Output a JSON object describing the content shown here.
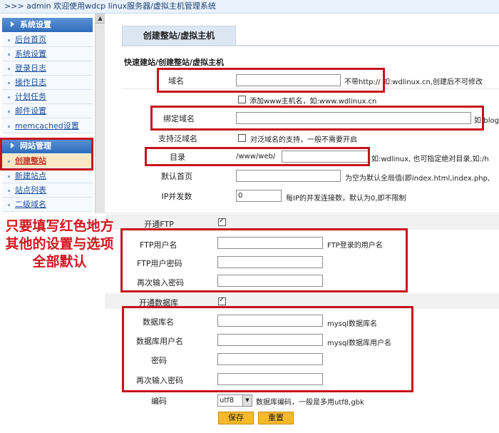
{
  "header": {
    "title": ">>> admin 欢迎使用wdcp linux服务器/虚拟主机管理系统"
  },
  "sidebar": {
    "section1": "系统设置",
    "items1": [
      "后台首页",
      "系统设置",
      "登录日志",
      "操作日志",
      "计划任务",
      "邮件设置",
      "memcached设置"
    ],
    "section2": "网站管理",
    "items2": [
      "创建整站",
      "新建站点",
      "站点列表",
      "二级域名"
    ]
  },
  "main": {
    "tab": "创建整站/虚拟主机",
    "section_title": "快速建站/创建整站/虚拟主机",
    "domain": {
      "label": "域名",
      "hint": "不带http:// 如:wdlinux.cn,创建后不可修改"
    },
    "add_www": {
      "label": "添加www主机名，如:www.wdlinux.cn"
    },
    "bind_domain": {
      "label": "绑定域名",
      "hint": "如:blog"
    },
    "wildcard": {
      "label": "支持泛域名",
      "hint": "对泛域名的支持，一般不需要开启"
    },
    "dir": {
      "label": "目录",
      "prefix": "/www/web/",
      "hint": "如:wdlinux, 也可指定绝对目录,如:/h"
    },
    "default_page": {
      "label": "默认首页",
      "hint": "为空为默认全局值(即index.html,index.php,"
    },
    "ip_conn": {
      "label": "IP并发数",
      "value": "0",
      "hint": "每IP的并发连接数，默认为0,即不限制"
    },
    "ftp_enable": {
      "label": "开通FTP"
    },
    "ftp_user": {
      "label": "FTP用户名",
      "hint": "FTP登录的用户名"
    },
    "ftp_pass": {
      "label": "FTP用户密码"
    },
    "ftp_pass2": {
      "label": "再次输入密码"
    },
    "db_enable": {
      "label": "开通数据库"
    },
    "db_name": {
      "label": "数据库名",
      "hint": "mysql数据库名"
    },
    "db_user": {
      "label": "数据库用户名",
      "hint": "mysql数据库用户名"
    },
    "db_pass": {
      "label": "密码"
    },
    "db_pass2": {
      "label": "再次输入密码"
    },
    "encoding": {
      "label": "编码",
      "value": "utf8",
      "hint": "数据库编码，一般是多用utf8,gbk"
    },
    "save_button": "保存",
    "reset_button": "重置"
  },
  "annotation": {
    "lines": [
      "只要填写红色地方",
      "其他的设置与选项",
      "全部默认"
    ]
  },
  "colors": {
    "annotation_red": "#d3151e",
    "box_red": "#c8121c",
    "button_orange": "#f7b82b",
    "sidebar_blue": "#2f6cba"
  }
}
